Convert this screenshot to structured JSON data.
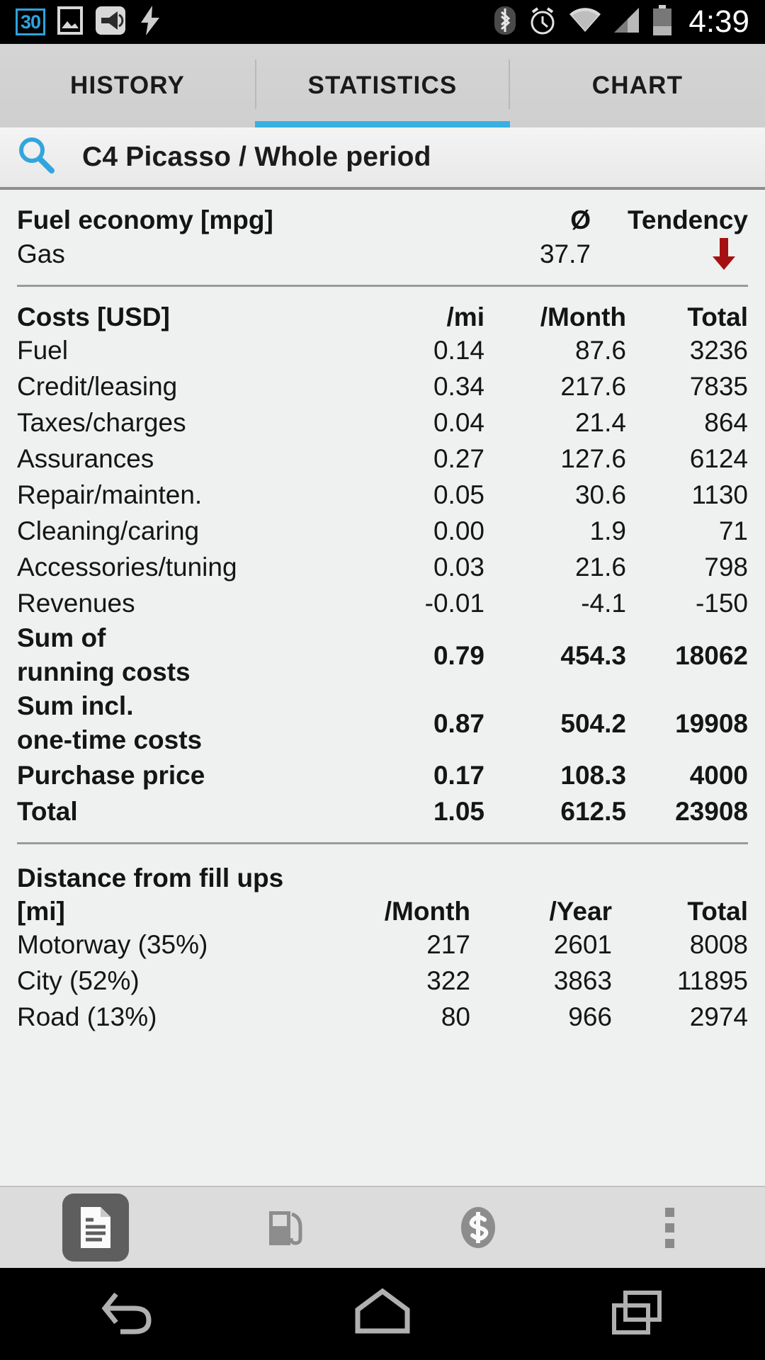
{
  "statusbar": {
    "left_icons": [
      {
        "name": "badge-30-icon",
        "label": "30"
      },
      {
        "name": "image-icon",
        "label": ""
      },
      {
        "name": "megaphone-icon",
        "label": ""
      },
      {
        "name": "charging-bolt-icon",
        "label": ""
      }
    ],
    "right_icons": [
      {
        "name": "bluetooth-icon"
      },
      {
        "name": "alarm-clock-icon"
      },
      {
        "name": "wifi-icon"
      },
      {
        "name": "cell-signal-icon"
      },
      {
        "name": "battery-icon"
      }
    ],
    "time": "4:39"
  },
  "tabs": [
    {
      "label": "HISTORY",
      "active": false
    },
    {
      "label": "STATISTICS",
      "active": true
    },
    {
      "label": "CHART",
      "active": false
    }
  ],
  "accent_color": "#38b0e3",
  "search": {
    "icon": "search-icon",
    "title": "C4 Picasso / Whole period"
  },
  "fuel_economy": {
    "header": {
      "title": "Fuel economy [mpg]",
      "avg": "Ø",
      "tendency": "Tendency"
    },
    "rows": [
      {
        "label": "Gas",
        "avg": "37.7",
        "tendency": "down",
        "tendency_color": "#a51111"
      }
    ]
  },
  "costs": {
    "header": {
      "title": "Costs [USD]",
      "per_distance": "/mi",
      "per_month": "/Month",
      "total": "Total"
    },
    "rows": [
      {
        "label": "Fuel",
        "mi": "0.14",
        "month": "87.6",
        "total": "3236",
        "bold": false
      },
      {
        "label": "Credit/leasing",
        "mi": "0.34",
        "month": "217.6",
        "total": "7835",
        "bold": false
      },
      {
        "label": "Taxes/charges",
        "mi": "0.04",
        "month": "21.4",
        "total": "864",
        "bold": false
      },
      {
        "label": "Assurances",
        "mi": "0.27",
        "month": "127.6",
        "total": "6124",
        "bold": false
      },
      {
        "label": "Repair/mainten.",
        "mi": "0.05",
        "month": "30.6",
        "total": "1130",
        "bold": false
      },
      {
        "label": "Cleaning/caring",
        "mi": "0.00",
        "month": "1.9",
        "total": "71",
        "bold": false
      },
      {
        "label": "Accessories/tuning",
        "mi": "0.03",
        "month": "21.6",
        "total": "798",
        "bold": false
      },
      {
        "label": "Revenues",
        "mi": "-0.01",
        "month": "-4.1",
        "total": "-150",
        "bold": false
      },
      {
        "label": "Sum of\nrunning costs",
        "mi": "0.79",
        "month": "454.3",
        "total": "18062",
        "bold": true
      },
      {
        "label": "Sum incl.\none-time costs",
        "mi": "0.87",
        "month": "504.2",
        "total": "19908",
        "bold": true
      },
      {
        "label": "Purchase price",
        "mi": "0.17",
        "month": "108.3",
        "total": "4000",
        "bold": true
      },
      {
        "label": "Total",
        "mi": "1.05",
        "month": "612.5",
        "total": "23908",
        "bold": true
      }
    ]
  },
  "distance": {
    "section_title": "Distance from fill ups",
    "header": {
      "unit": "[mi]",
      "per_month": "/Month",
      "per_year": "/Year",
      "total": "Total"
    },
    "rows": [
      {
        "label": "Motorway (35%)",
        "month": "217",
        "year": "2601",
        "total": "8008"
      },
      {
        "label": "City (52%)",
        "month": "322",
        "year": "3863",
        "total": "11895"
      },
      {
        "label": "Road (13%)",
        "month": "80",
        "year": "966",
        "total": "2974"
      }
    ]
  },
  "toolbar": [
    {
      "name": "report-document-icon",
      "selected": true
    },
    {
      "name": "fuel-pump-icon",
      "selected": false
    },
    {
      "name": "dollar-coin-icon",
      "selected": false
    },
    {
      "name": "overflow-menu-icon",
      "selected": false
    }
  ],
  "navbar": [
    {
      "name": "back-nav-icon"
    },
    {
      "name": "home-nav-icon"
    },
    {
      "name": "recents-nav-icon"
    }
  ]
}
